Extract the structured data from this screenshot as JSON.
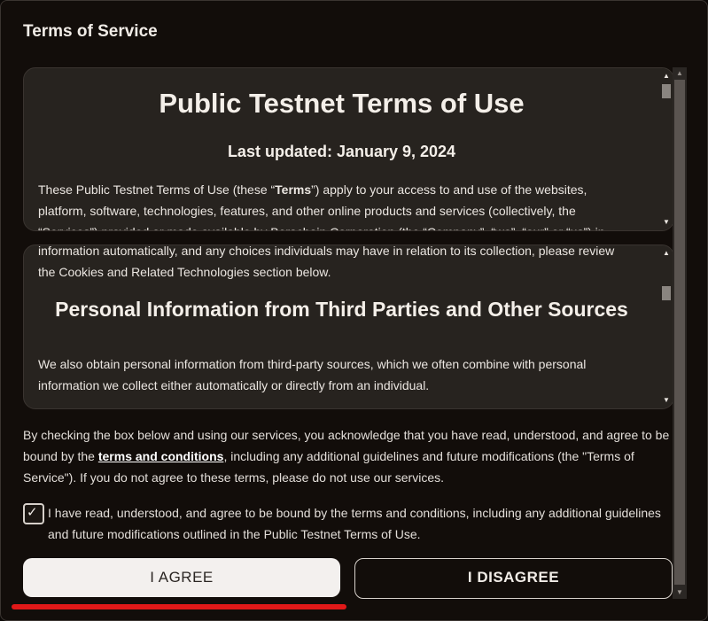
{
  "dialog": {
    "title": "Terms of Service"
  },
  "terms_panel": {
    "heading": "Public Testnet Terms of Use",
    "updated": "Last updated: January 9, 2024",
    "line1_pre": "These Public Testnet Terms of Use (these “",
    "line1_bold": "Terms",
    "line1_post": "”) apply to your access to and use of the websites,",
    "line2": "platform, software, technologies, features, and other online products and services (collectively, the",
    "line3_partial": "“Services”) provided or made available by Berachain Corporation (the “Company”, “we”, “our” or “us”) in"
  },
  "privacy_panel": {
    "line_top": "information automatically, and any choices individuals may have in relation to its collection, please review",
    "line_2": "the Cookies and Related Technologies section below.",
    "heading": "Personal Information from Third Parties and Other Sources",
    "para1": "We also obtain personal information from third-party sources, which we often combine with personal",
    "para2": "information we collect either automatically or directly from an individual."
  },
  "consent": {
    "text_pre": "By checking the box below and using our services, you acknowledge that you have read, understood, and agree to be bound by the ",
    "link": "terms and conditions",
    "text_post": ", including any additional guidelines and future modifications (the \"Terms of Service\"). If you do not agree to these terms, please do not use our services."
  },
  "checkbox": {
    "checked": true,
    "label": "I have read, understood, and agree to be bound by the terms and conditions, including any additional guidelines and future modifications outlined in the Public Testnet Terms of Use."
  },
  "buttons": {
    "agree": "I AGREE",
    "disagree": "I DISAGREE"
  },
  "icons": {
    "scroll_up": "▲",
    "scroll_down": "▼",
    "check": "✓"
  },
  "colors": {
    "accent_underline": "#e01818",
    "agree_bg": "#f3f0ee",
    "panel_bg": "#27231f"
  }
}
